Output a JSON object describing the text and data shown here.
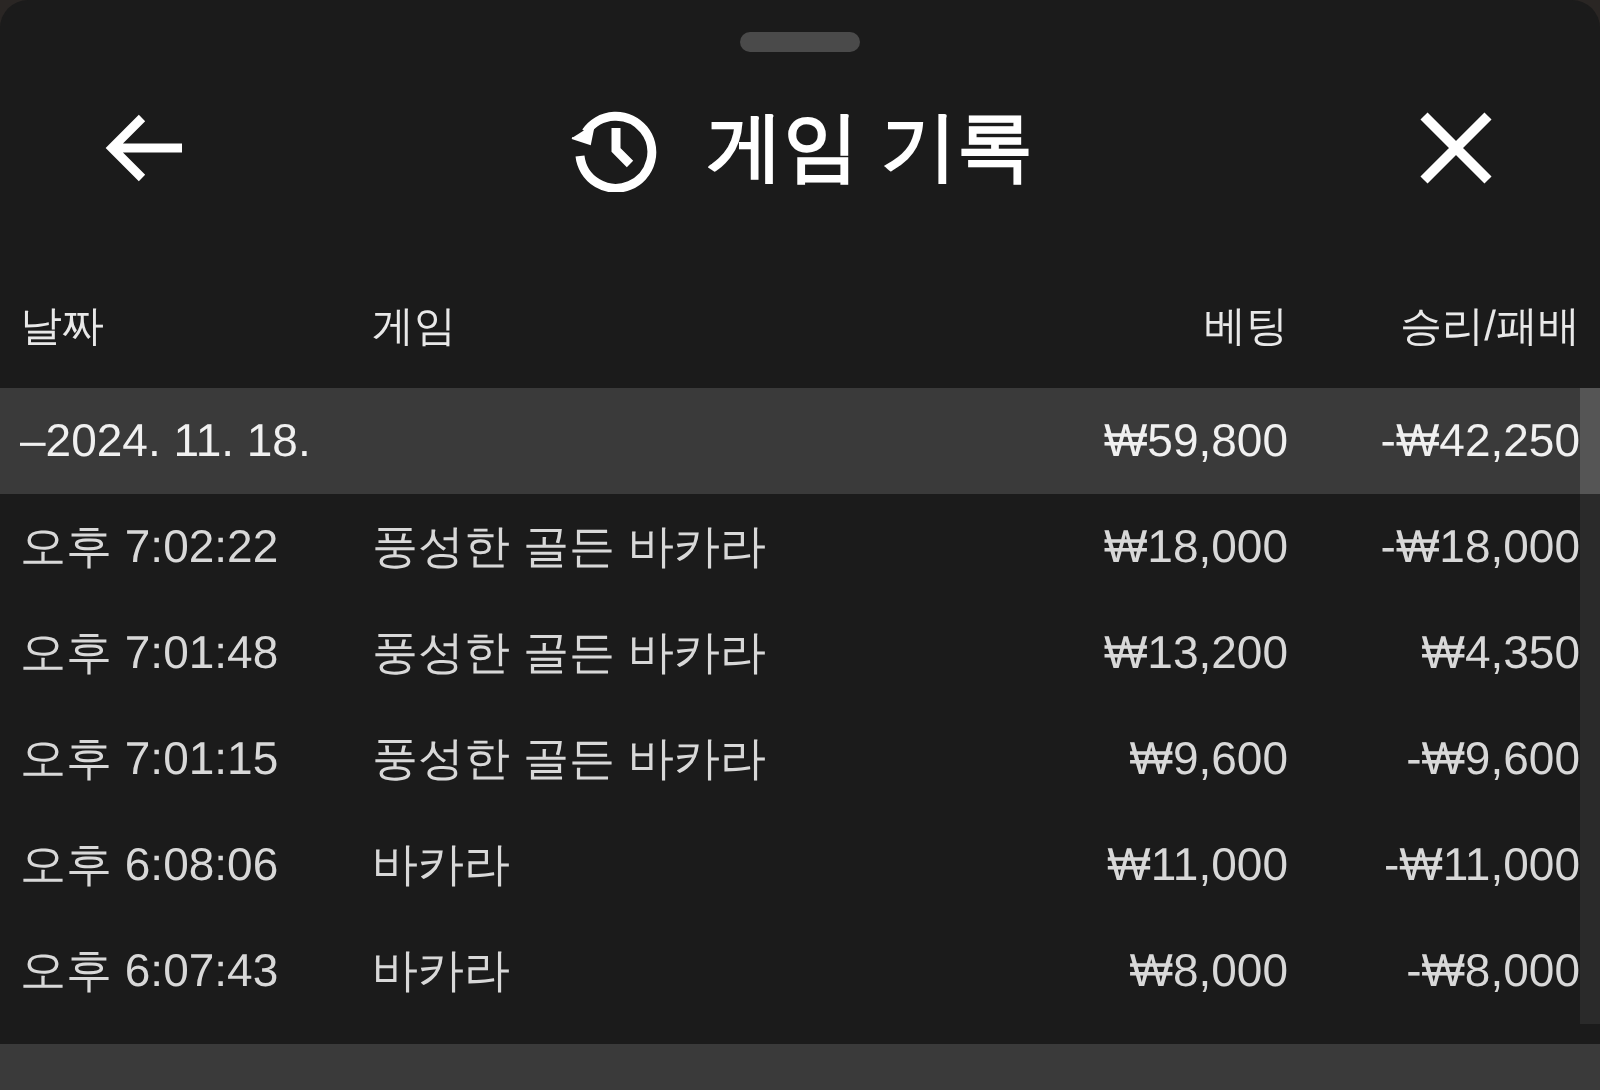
{
  "header": {
    "title": "게임 기록"
  },
  "table": {
    "columns": [
      "날짜",
      "게임",
      "베팅",
      "승리/패배"
    ],
    "group": {
      "date": "–2024. 11. 18.",
      "bet": "₩59,800",
      "result": "-₩42,250"
    },
    "rows": [
      {
        "time": "오후 7:02:22",
        "game": "풍성한 골든 바카라",
        "bet": "₩18,000",
        "result": "-₩18,000"
      },
      {
        "time": "오후 7:01:48",
        "game": "풍성한 골든 바카라",
        "bet": "₩13,200",
        "result": "₩4,350"
      },
      {
        "time": "오후 7:01:15",
        "game": "풍성한 골든 바카라",
        "bet": "₩9,600",
        "result": "-₩9,600"
      },
      {
        "time": "오후 6:08:06",
        "game": "바카라",
        "bet": "₩11,000",
        "result": "-₩11,000"
      },
      {
        "time": "오후 6:07:43",
        "game": "바카라",
        "bet": "₩8,000",
        "result": "-₩8,000"
      }
    ]
  }
}
